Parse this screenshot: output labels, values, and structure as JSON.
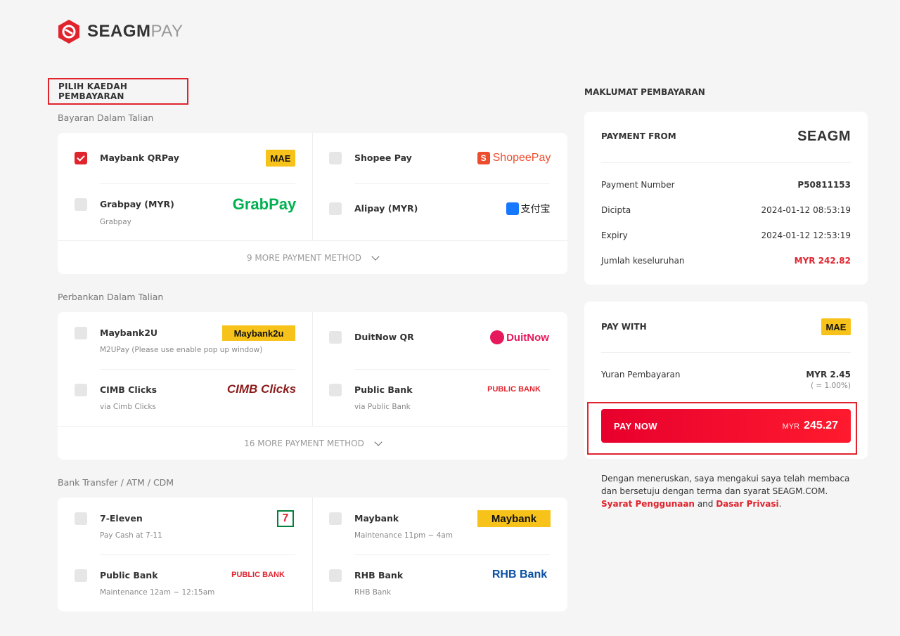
{
  "brand": {
    "name_main": "SEAGM",
    "name_suffix": "PAY",
    "accent": "#e0242e"
  },
  "choose_title": "PILIH KAEDAH PEMBAYARAN",
  "sections": {
    "online": {
      "label": "Bayaran Dalam Talian",
      "methods": [
        {
          "name": "Maybank QRPay",
          "sub": "",
          "checked": true,
          "logo": "MAE"
        },
        {
          "name": "Shopee Pay",
          "sub": "",
          "checked": false,
          "logo": "ShopeePay"
        },
        {
          "name": "Grabpay (MYR)",
          "sub": "Grabpay",
          "checked": false,
          "logo": "GrabPay"
        },
        {
          "name": "Alipay (MYR)",
          "sub": "",
          "checked": false,
          "logo": "支付宝"
        }
      ],
      "more": "9 MORE PAYMENT METHOD"
    },
    "banking": {
      "label": "Perbankan Dalam Talian",
      "methods": [
        {
          "name": "Maybank2U",
          "sub": "M2UPay (Please use enable pop up window)",
          "checked": false,
          "logo": "Maybank2u"
        },
        {
          "name": "DuitNow QR",
          "sub": "",
          "checked": false,
          "logo": "DuitNow"
        },
        {
          "name": "CIMB Clicks",
          "sub": "via Cimb Clicks",
          "checked": false,
          "logo": "CIMB Clicks"
        },
        {
          "name": "Public Bank",
          "sub": "via Public Bank",
          "checked": false,
          "logo": "PUBLIC BANK"
        }
      ],
      "more": "16 MORE PAYMENT METHOD"
    },
    "transfer": {
      "label": "Bank Transfer / ATM / CDM",
      "methods": [
        {
          "name": "7-Eleven",
          "sub": "Pay Cash at 7-11",
          "checked": false,
          "logo": "7"
        },
        {
          "name": "Maybank",
          "sub": "Maintenance 11pm ~ 4am",
          "checked": false,
          "logo": "Maybank"
        },
        {
          "name": "Public Bank",
          "sub": "Maintenance 12am ~ 12:15am",
          "checked": false,
          "logo": "PUBLIC BANK"
        },
        {
          "name": "RHB Bank",
          "sub": "RHB Bank",
          "checked": false,
          "logo": "RHB Bank"
        }
      ]
    }
  },
  "info": {
    "title": "MAKLUMAT PEMBAYARAN",
    "payment_from": "PAYMENT FROM",
    "merchant_logo": "SEAGM",
    "rows": [
      {
        "label": "Payment Number",
        "value": "P50811153"
      },
      {
        "label": "Dicipta",
        "value": "2024-01-12 08:53:19"
      },
      {
        "label": "Expiry",
        "value": "2024-01-12 12:53:19"
      },
      {
        "label": "Jumlah keseluruhan",
        "value": "MYR 242.82"
      }
    ]
  },
  "pay": {
    "pay_with": "PAY WITH",
    "method_logo": "MAE",
    "fee_label": "Yuran Pembayaran",
    "fee_value": "MYR 2.45",
    "fee_rate": "( = 1.00%)",
    "button_label": "PAY NOW",
    "button_currency": "MYR",
    "button_amount": "245.27"
  },
  "terms": {
    "text": "Dengan meneruskan, saya mengakui saya telah membaca dan bersetuju dengan terma dan syarat SEAGM.COM.",
    "link_terms": "Syarat Penggunaan",
    "and": "and",
    "link_privacy": "Dasar Privasi",
    "end": "."
  }
}
